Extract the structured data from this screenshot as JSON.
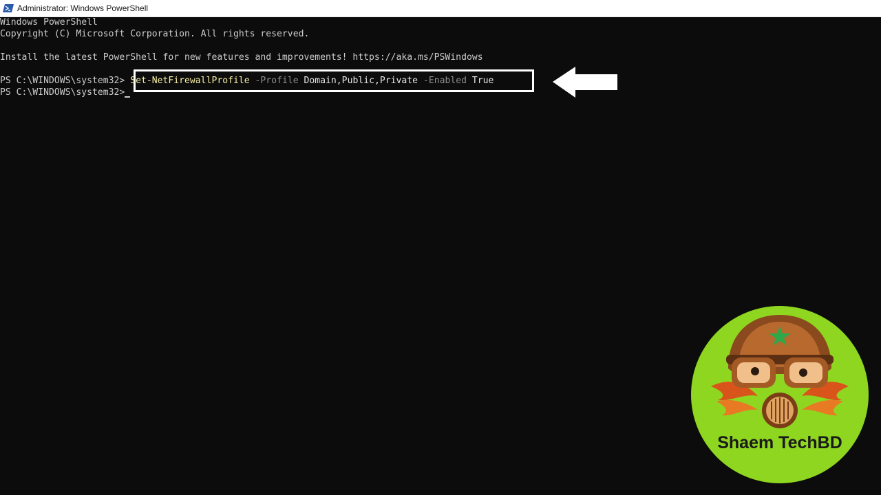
{
  "window": {
    "title": "Administrator: Windows PowerShell",
    "icon": "powershell-icon"
  },
  "console": {
    "line1": "Windows PowerShell",
    "line2": "Copyright (C) Microsoft Corporation. All rights reserved.",
    "line4": "Install the latest PowerShell for new features and improvements! https://aka.ms/PSWindows",
    "prompt": "PS C:\\WINDOWS\\system32>",
    "command": {
      "cmdlet": "Set-NetFirewallProfile",
      "param1": "-Profile",
      "value1": "Domain,Public,Private",
      "param2": "-Enabled",
      "value2": "True"
    }
  },
  "annotation": {
    "arrow_icon": "left-arrow-icon",
    "highlight_color": "#ffffff"
  },
  "logo": {
    "text": "Shaem TechBD",
    "background": "#8ed61f"
  },
  "colors": {
    "console_bg": "#0c0c0c",
    "console_text": "#cccccc",
    "cmdlet": "#f9f1a5",
    "parameter": "#8f8f8f"
  }
}
